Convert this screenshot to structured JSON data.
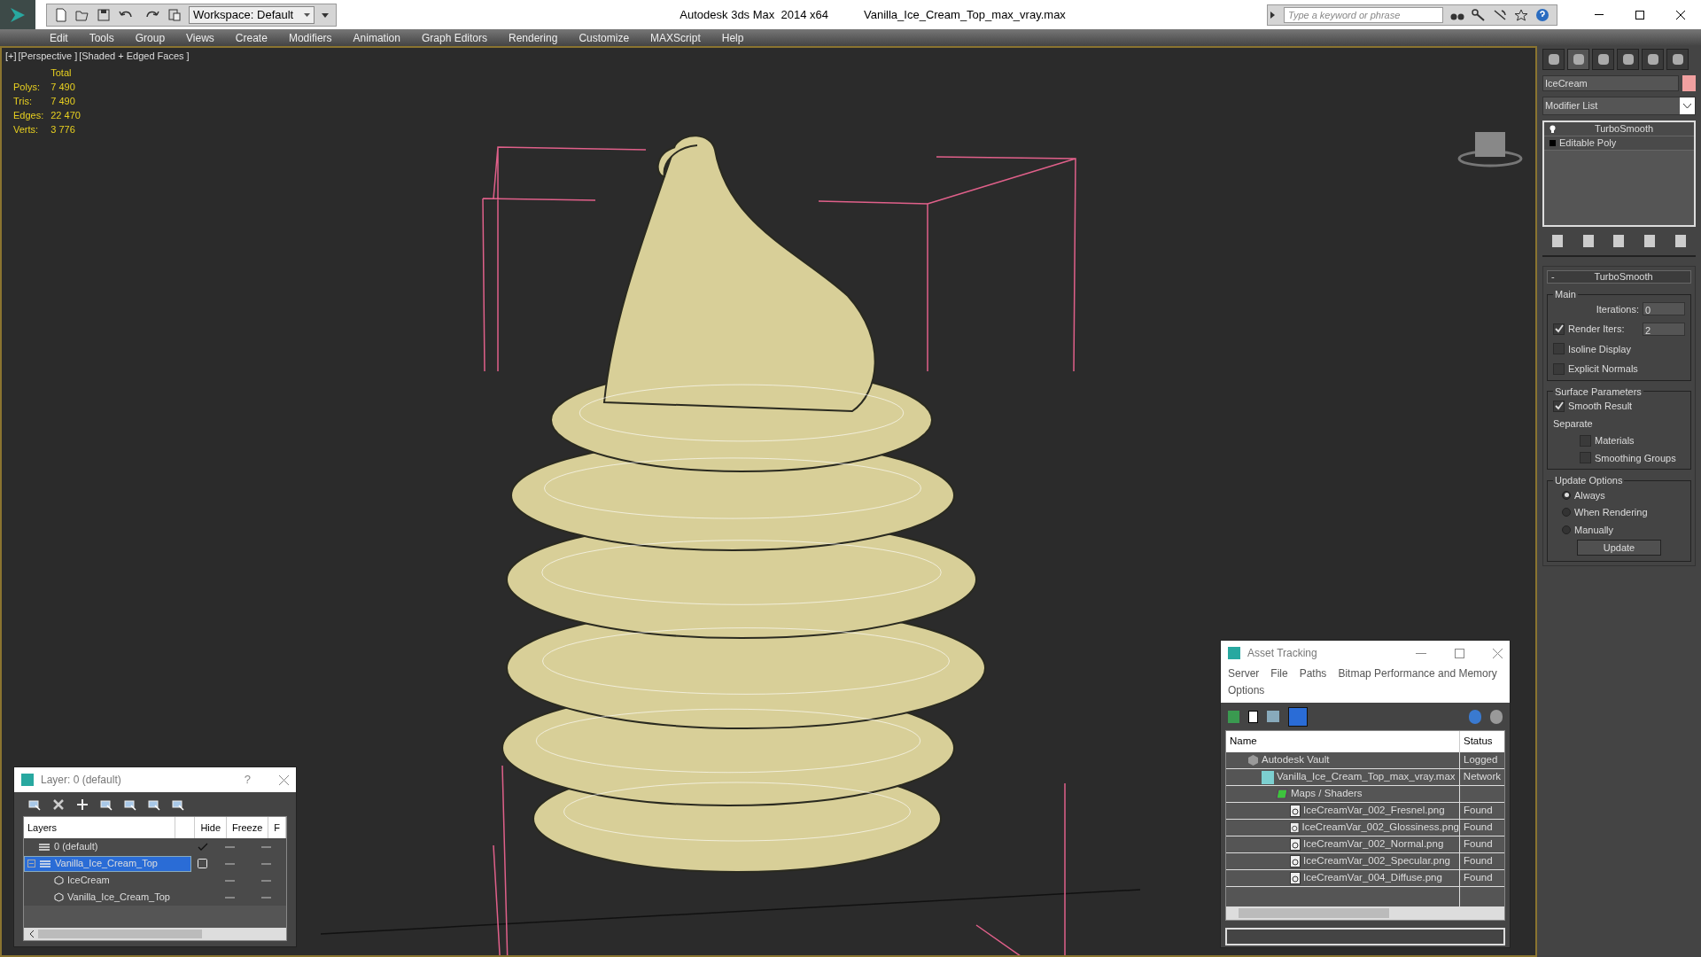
{
  "window": {
    "app_title": "Autodesk 3ds Max  2014 x64",
    "file_title": "Vanilla_Ice_Cream_Top_max_vray.max",
    "workspace": "Workspace: Default",
    "search_placeholder": "Type a keyword or phrase"
  },
  "menu": [
    "Edit",
    "Tools",
    "Group",
    "Views",
    "Create",
    "Modifiers",
    "Animation",
    "Graph Editors",
    "Rendering",
    "Customize",
    "MAXScript",
    "Help"
  ],
  "viewport": {
    "labels": [
      "[+]",
      "[Perspective ]",
      "[Shaded + Edged Faces ]"
    ],
    "stats_header": "Total",
    "stats": [
      {
        "label": "Polys:",
        "value": "7 490"
      },
      {
        "label": "Tris:",
        "value": "7 490"
      },
      {
        "label": "Edges:",
        "value": "22 470"
      },
      {
        "label": "Verts:",
        "value": "3 776"
      }
    ]
  },
  "command_panel": {
    "object_name": "IceCream",
    "modifier_list": "Modifier List",
    "stack": [
      {
        "label": "TurboSmooth",
        "kind": "modifier"
      },
      {
        "label": "Editable Poly",
        "kind": "base"
      }
    ],
    "rollout_title": "TurboSmooth",
    "rollout_collapse": "-",
    "main": {
      "title": "Main",
      "iterations_label": "Iterations:",
      "iterations": "0",
      "render_iters_label": "Render Iters:",
      "render_iters_checked": true,
      "render_iters": "2",
      "options": [
        {
          "label": "Isoline Display",
          "checked": false
        },
        {
          "label": "Explicit Normals",
          "checked": false
        }
      ]
    },
    "surface": {
      "title": "Surface Parameters",
      "smooth_result": {
        "label": "Smooth Result",
        "checked": true
      },
      "separate_label": "Separate",
      "separate": [
        {
          "label": "Materials",
          "checked": false
        },
        {
          "label": "Smoothing Groups",
          "checked": false
        }
      ]
    },
    "update": {
      "title": "Update Options",
      "options": [
        {
          "label": "Always",
          "selected": true
        },
        {
          "label": "When Rendering",
          "selected": false
        },
        {
          "label": "Manually",
          "selected": false
        }
      ],
      "button": "Update"
    }
  },
  "layer_dialog": {
    "title": "Layer: 0 (default)",
    "help": "?",
    "columns": [
      "Layers",
      "Hide",
      "Freeze",
      "F"
    ],
    "layers": [
      {
        "name": "0 (default)",
        "current": true,
        "selected": false,
        "expanded": false
      },
      {
        "name": "Vanilla_Ice_Cream_Top",
        "current": false,
        "selected": true,
        "expanded": true,
        "children": [
          {
            "name": "IceCream"
          },
          {
            "name": "Vanilla_Ice_Cream_Top"
          }
        ]
      }
    ]
  },
  "asset_tracking": {
    "title": "Asset Tracking",
    "menu": [
      "Server",
      "File",
      "Paths",
      "Bitmap Performance and Memory",
      "Options"
    ],
    "columns": [
      "Name",
      "Status"
    ],
    "tree": [
      {
        "name": "Autodesk Vault",
        "kind": "vault",
        "status": "Logged",
        "children": [
          {
            "name": "Vanilla_Ice_Cream_Top_max_vray.max",
            "kind": "max",
            "status": "Network",
            "children": [
              {
                "name": "Maps / Shaders",
                "kind": "folder",
                "children": [
                  {
                    "name": "IceCreamVar_002_Fresnel.png",
                    "kind": "image",
                    "status": "Found"
                  },
                  {
                    "name": "IceCreamVar_002_Glossiness.png",
                    "kind": "image",
                    "status": "Found"
                  },
                  {
                    "name": "IceCreamVar_002_Normal.png",
                    "kind": "image",
                    "status": "Found"
                  },
                  {
                    "name": "IceCreamVar_002_Specular.png",
                    "kind": "image",
                    "status": "Found"
                  },
                  {
                    "name": "IceCreamVar_004_Diffuse.png",
                    "kind": "image",
                    "status": "Found"
                  }
                ]
              }
            ]
          }
        ]
      }
    ]
  }
}
